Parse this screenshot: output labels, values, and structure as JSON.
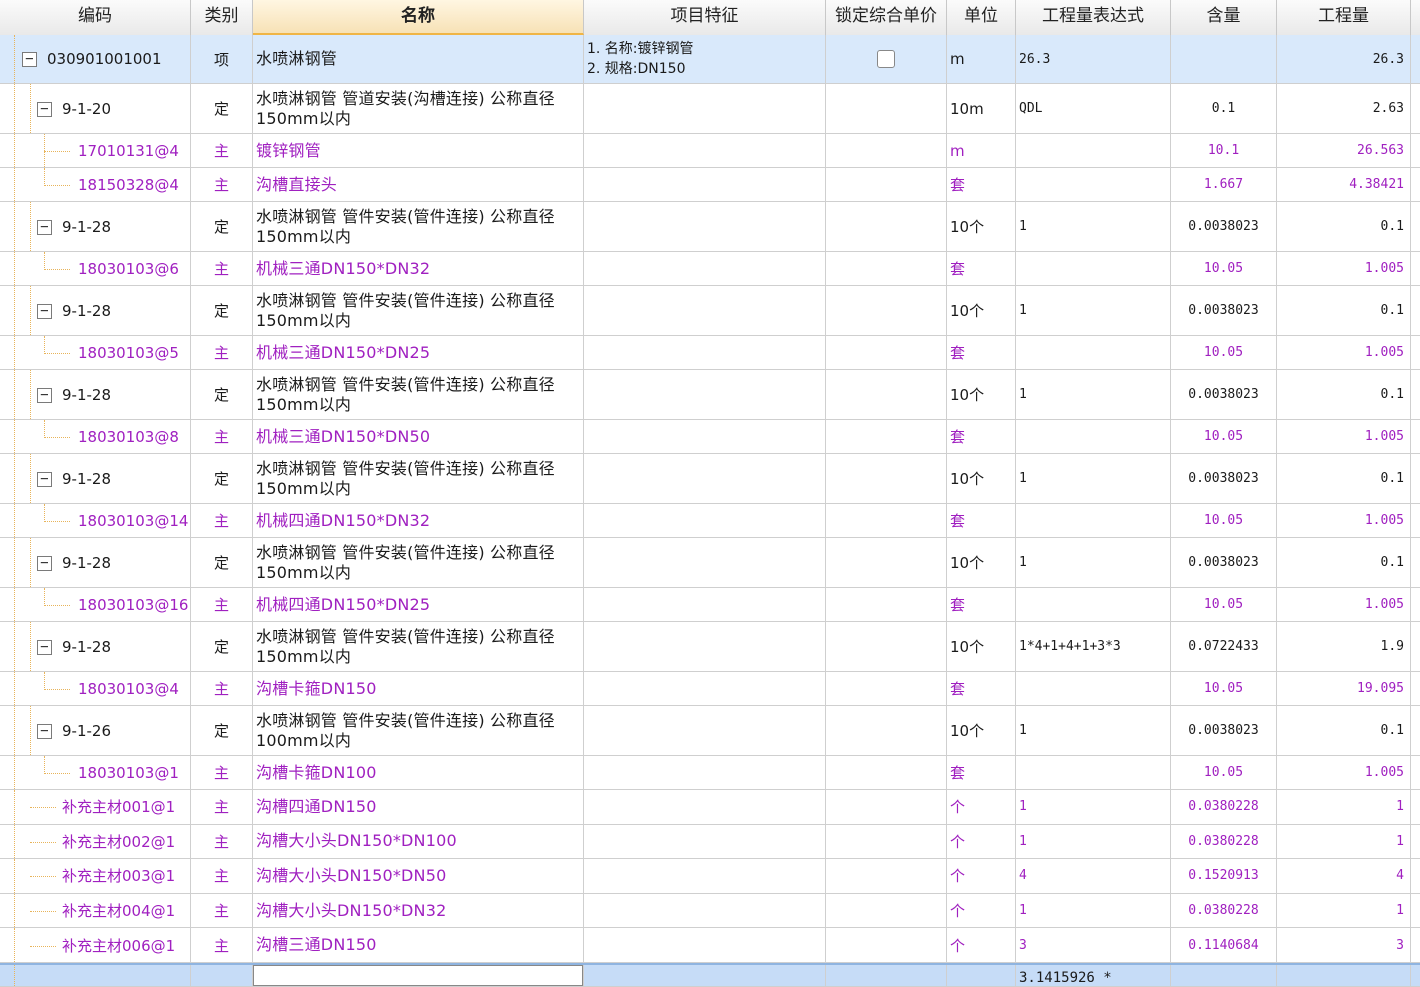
{
  "headers": [
    "编码",
    "类别",
    "名称",
    "项目特征",
    "锁定综合单价",
    "单位",
    "工程量表达式",
    "含量",
    "工程量"
  ],
  "rows": [
    {
      "type": "item",
      "level": 0,
      "toggle": "minus",
      "code": "030901001001",
      "cat": "项",
      "name": "水喷淋钢管",
      "feature": [
        "1. 名称:镀锌钢管",
        "2. 规格:DN150"
      ],
      "lock": true,
      "unit": "m",
      "expr": "26.3",
      "content": "",
      "qty": "26.3",
      "selected": true
    },
    {
      "type": "quota",
      "level": 1,
      "toggle": "minus",
      "code": "9-1-20",
      "cat": "定",
      "name": "水喷淋钢管 管道安装(沟槽连接) 公称直径150mm以内",
      "unit": "10m",
      "expr": "QDL",
      "content": "0.1",
      "qty": "2.63"
    },
    {
      "type": "main",
      "level": 2,
      "code": "17010131@4",
      "cat": "主",
      "name": "镀锌钢管",
      "unit": "m",
      "expr": "",
      "content": "10.1",
      "qty": "26.563"
    },
    {
      "type": "main",
      "level": 2,
      "code": "18150328@4",
      "cat": "主",
      "name": "沟槽直接头",
      "unit": "套",
      "expr": "",
      "content": "1.667",
      "qty": "4.38421"
    },
    {
      "type": "quota",
      "level": 1,
      "toggle": "minus",
      "code": "9-1-28",
      "cat": "定",
      "name": "水喷淋钢管 管件安装(管件连接) 公称直径150mm以内",
      "unit": "10个",
      "expr": "1",
      "content": "0.0038023",
      "qty": "0.1"
    },
    {
      "type": "main",
      "level": 2,
      "code": "18030103@6",
      "cat": "主",
      "name": "机械三通DN150*DN32",
      "unit": "套",
      "expr": "",
      "content": "10.05",
      "qty": "1.005"
    },
    {
      "type": "quota",
      "level": 1,
      "toggle": "minus",
      "code": "9-1-28",
      "cat": "定",
      "name": "水喷淋钢管 管件安装(管件连接) 公称直径150mm以内",
      "unit": "10个",
      "expr": "1",
      "content": "0.0038023",
      "qty": "0.1"
    },
    {
      "type": "main",
      "level": 2,
      "code": "18030103@5",
      "cat": "主",
      "name": "机械三通DN150*DN25",
      "unit": "套",
      "expr": "",
      "content": "10.05",
      "qty": "1.005"
    },
    {
      "type": "quota",
      "level": 1,
      "toggle": "minus",
      "code": "9-1-28",
      "cat": "定",
      "name": "水喷淋钢管 管件安装(管件连接) 公称直径150mm以内",
      "unit": "10个",
      "expr": "1",
      "content": "0.0038023",
      "qty": "0.1"
    },
    {
      "type": "main",
      "level": 2,
      "code": "18030103@8",
      "cat": "主",
      "name": "机械三通DN150*DN50",
      "unit": "套",
      "expr": "",
      "content": "10.05",
      "qty": "1.005"
    },
    {
      "type": "quota",
      "level": 1,
      "toggle": "minus",
      "code": "9-1-28",
      "cat": "定",
      "name": "水喷淋钢管 管件安装(管件连接) 公称直径150mm以内",
      "unit": "10个",
      "expr": "1",
      "content": "0.0038023",
      "qty": "0.1"
    },
    {
      "type": "main",
      "level": 2,
      "code": "18030103@14",
      "cat": "主",
      "name": "机械四通DN150*DN32",
      "unit": "套",
      "expr": "",
      "content": "10.05",
      "qty": "1.005"
    },
    {
      "type": "quota",
      "level": 1,
      "toggle": "minus",
      "code": "9-1-28",
      "cat": "定",
      "name": "水喷淋钢管 管件安装(管件连接) 公称直径150mm以内",
      "unit": "10个",
      "expr": "1",
      "content": "0.0038023",
      "qty": "0.1"
    },
    {
      "type": "main",
      "level": 2,
      "code": "18030103@16",
      "cat": "主",
      "name": "机械四通DN150*DN25",
      "unit": "套",
      "expr": "",
      "content": "10.05",
      "qty": "1.005"
    },
    {
      "type": "quota",
      "level": 1,
      "toggle": "minus",
      "code": "9-1-28",
      "cat": "定",
      "name": "水喷淋钢管 管件安装(管件连接) 公称直径150mm以内",
      "unit": "10个",
      "expr": "1*4+1+4+1+3*3",
      "content": "0.0722433",
      "qty": "1.9"
    },
    {
      "type": "main",
      "level": 2,
      "code": "18030103@4",
      "cat": "主",
      "name": "沟槽卡箍DN150",
      "unit": "套",
      "expr": "",
      "content": "10.05",
      "qty": "19.095"
    },
    {
      "type": "quota",
      "level": 1,
      "toggle": "minus",
      "code": "9-1-26",
      "cat": "定",
      "name": "水喷淋钢管 管件安装(管件连接) 公称直径100mm以内",
      "unit": "10个",
      "expr": "1",
      "content": "0.0038023",
      "qty": "0.1"
    },
    {
      "type": "main",
      "level": 2,
      "code": "18030103@1",
      "cat": "主",
      "name": "沟槽卡箍DN100",
      "unit": "套",
      "expr": "",
      "content": "10.05",
      "qty": "1.005"
    },
    {
      "type": "main",
      "level": 1,
      "code": "补充主材001@1",
      "cat": "主",
      "name": "沟槽四通DN150",
      "unit": "个",
      "expr": "1",
      "content": "0.0380228",
      "qty": "1"
    },
    {
      "type": "main",
      "level": 1,
      "code": "补充主材002@1",
      "cat": "主",
      "name": "沟槽大小头DN150*DN100",
      "unit": "个",
      "expr": "1",
      "content": "0.0380228",
      "qty": "1"
    },
    {
      "type": "main",
      "level": 1,
      "code": "补充主材003@1",
      "cat": "主",
      "name": "沟槽大小头DN150*DN50",
      "unit": "个",
      "expr": "4",
      "content": "0.1520913",
      "qty": "4"
    },
    {
      "type": "main",
      "level": 1,
      "code": "补充主材004@1",
      "cat": "主",
      "name": "沟槽大小头DN150*DN32",
      "unit": "个",
      "expr": "1",
      "content": "0.0380228",
      "qty": "1"
    },
    {
      "type": "main",
      "level": 1,
      "code": "补充主材006@1",
      "cat": "主",
      "name": "沟槽三通DN150",
      "unit": "个",
      "expr": "3",
      "content": "0.1140684",
      "qty": "3"
    },
    {
      "type": "edit",
      "level": 0,
      "code": "",
      "cat": "",
      "name": "",
      "unit": "",
      "expr": "3.1415926 *",
      "content": "",
      "qty": ""
    }
  ]
}
